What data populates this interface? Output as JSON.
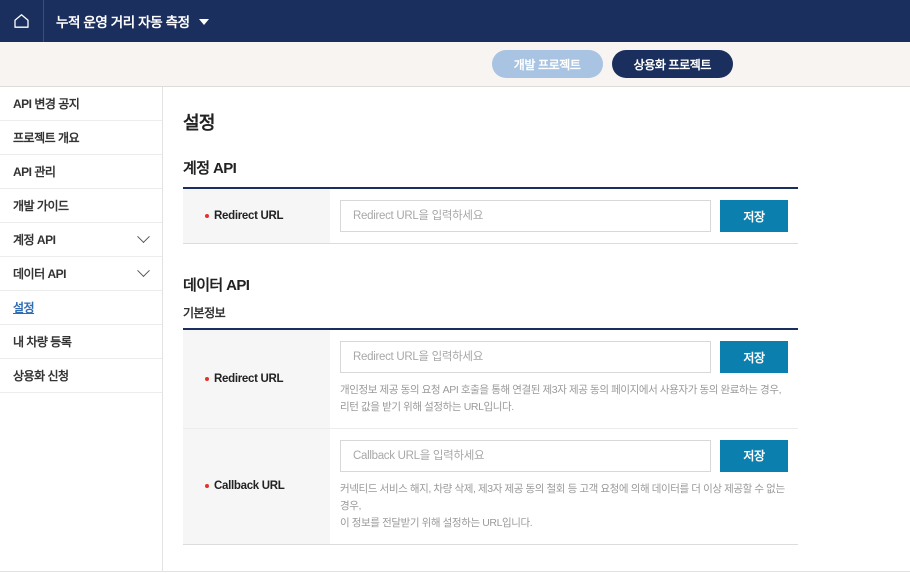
{
  "header": {
    "home_icon": "home-icon",
    "title": "누적 운영 거리 자동 측정",
    "dropdown_icon": "caret-down-icon"
  },
  "tabs": {
    "dev_label": "개발 프로젝트",
    "prod_label": "상용화 프로젝트",
    "selected": "상용화 프로젝트"
  },
  "sidebar": {
    "items": [
      {
        "label": "API 변경 공지",
        "expandable": false,
        "active": false
      },
      {
        "label": "프로젝트 개요",
        "expandable": false,
        "active": false
      },
      {
        "label": "API 관리",
        "expandable": false,
        "active": false
      },
      {
        "label": "개발 가이드",
        "expandable": false,
        "active": false
      },
      {
        "label": "계정 API",
        "expandable": true,
        "active": false
      },
      {
        "label": "데이터 API",
        "expandable": true,
        "active": false
      },
      {
        "label": "설정",
        "expandable": false,
        "active": true
      },
      {
        "label": "내 차량 등록",
        "expandable": false,
        "active": false
      },
      {
        "label": "상용화 신청",
        "expandable": false,
        "active": false
      }
    ]
  },
  "main": {
    "page_title": "설정",
    "account_api": {
      "section_title": "계정 API",
      "rows": [
        {
          "label": "Redirect URL",
          "required": true,
          "placeholder": "Redirect URL을 입력하세요",
          "value": "",
          "save_label": "저장",
          "desc_line1": "",
          "desc_line2": ""
        }
      ]
    },
    "data_api": {
      "section_title": "데이터 API",
      "sub_title": "기본정보",
      "rows": [
        {
          "label": "Redirect URL",
          "required": true,
          "placeholder": "Redirect URL을 입력하세요",
          "value": "",
          "save_label": "저장",
          "desc_line1": "개인정보 제공 동의 요청 API 호출을 통해 연결된 제3자 제공 동의 페이지에서 사용자가 동의 완료하는 경우,",
          "desc_line2": "리턴 값을 받기 위해 설정하는 URL입니다."
        },
        {
          "label": "Callback URL",
          "required": true,
          "placeholder": "Callback URL을 입력하세요",
          "value": "",
          "save_label": "저장",
          "desc_line1": "커넥티드 서비스 해지, 차량 삭제, 제3자 제공 동의 철회 등 고객 요청에 의해 데이터를 더 이상 제공할 수 없는 경우,",
          "desc_line2": "이 정보를 전달받기 위해 설정하는 URL입니다."
        }
      ]
    }
  },
  "colors": {
    "navy": "#1b2f5e",
    "tab_inactive": "#a8c4e2",
    "tab_strip_bg": "#f7f4f2",
    "save_button": "#0b7fae",
    "active_link": "#2e6db4",
    "required_dot": "#e5332a",
    "label_cell_bg": "#f6f6f6",
    "desc_text": "#9a9a9a"
  }
}
